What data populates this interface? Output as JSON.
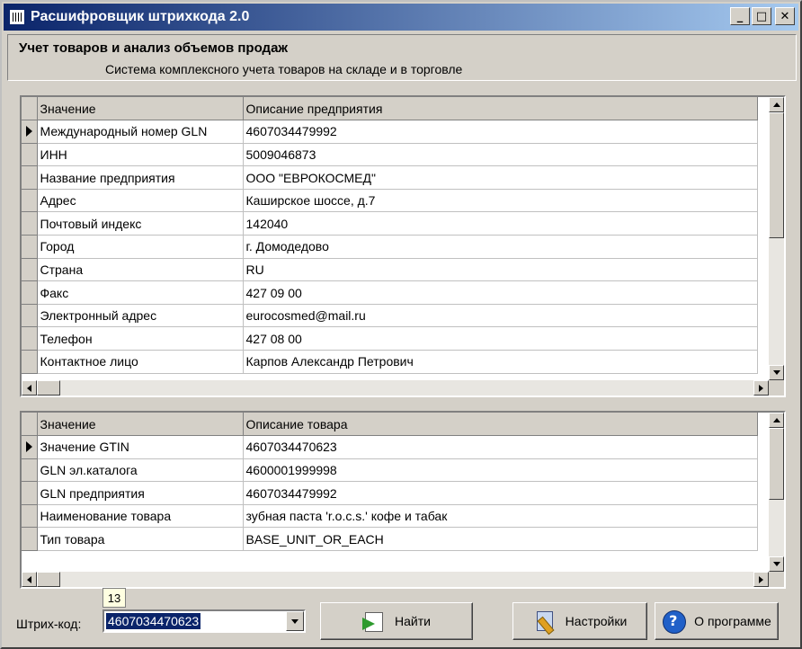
{
  "window": {
    "title": "Расшифровщик штрихкода 2.0"
  },
  "header": {
    "title": "Учет товаров и анализ объемов продаж",
    "subtitle": "Система комплексного учета товаров на складе и в торговле"
  },
  "company_grid": {
    "columns": [
      "Значение",
      "Описание предприятия"
    ],
    "rows": [
      [
        "Международный номер GLN",
        "4607034479992"
      ],
      [
        "ИНН",
        "5009046873"
      ],
      [
        "Название предприятия",
        "ООО \"ЕВРОКОСМЕД\""
      ],
      [
        "Адрес",
        "Каширское шоссе, д.7"
      ],
      [
        "Почтовый индекс",
        "142040"
      ],
      [
        "Город",
        "г. Домодедово"
      ],
      [
        "Страна",
        "RU"
      ],
      [
        "Факс",
        "427 09 00"
      ],
      [
        "Электронный адрес",
        "eurocosmed@mail.ru"
      ],
      [
        "Телефон",
        "427 08 00"
      ],
      [
        "Контактное лицо",
        "Карпов Александр Петрович"
      ]
    ]
  },
  "product_grid": {
    "columns": [
      "Значение",
      "Описание товара"
    ],
    "rows": [
      [
        "Значение GTIN",
        "4607034470623"
      ],
      [
        "GLN эл.каталога",
        "4600001999998"
      ],
      [
        "GLN предприятия",
        "4607034479992"
      ],
      [
        "Наименование товара",
        "зубная паста 'r.o.c.s.' кофе и табак"
      ],
      [
        "Тип товара",
        "BASE_UNIT_OR_EACH"
      ]
    ]
  },
  "footer": {
    "barcode_label": "Штрих-код:",
    "barcode_value": "4607034470623",
    "barcode_length": "13",
    "find_label": "Найти",
    "settings_label": "Настройки",
    "about_label": "О программе"
  }
}
